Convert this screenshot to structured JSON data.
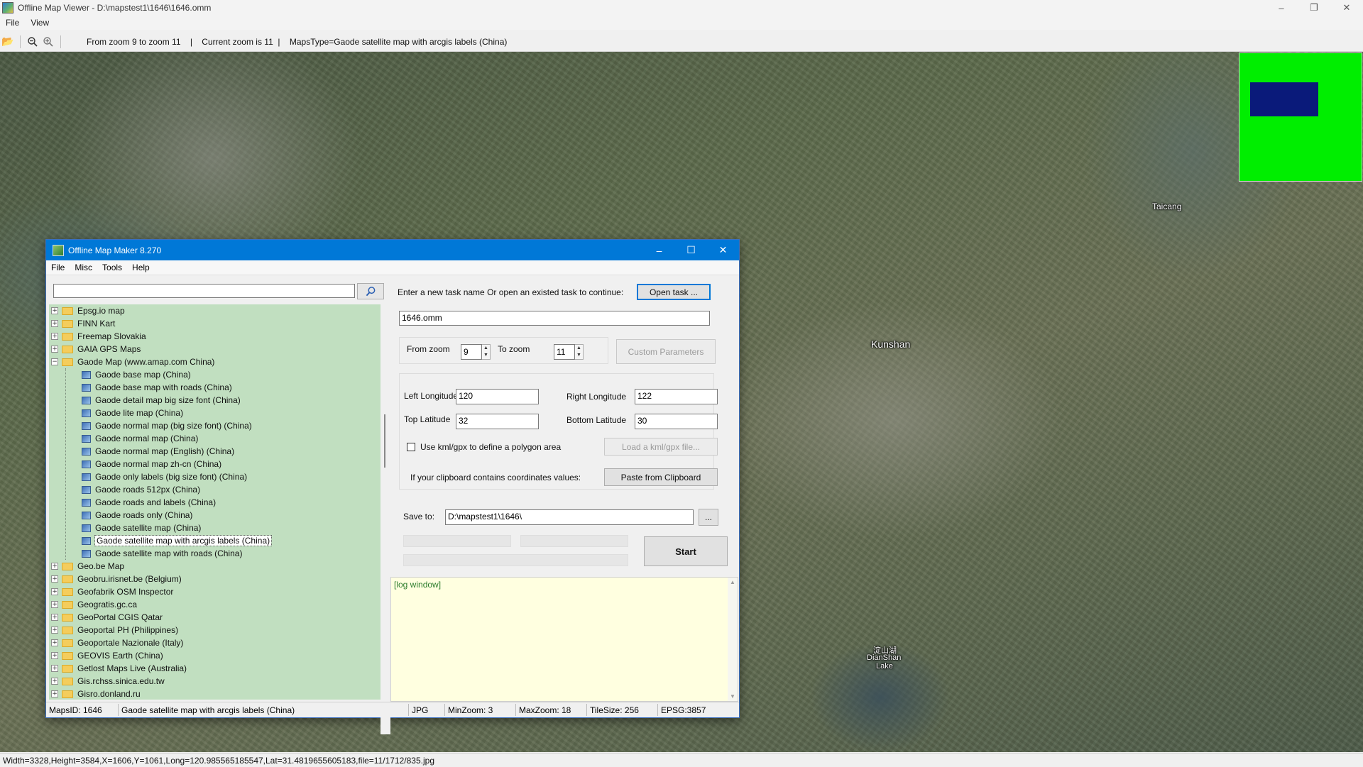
{
  "window": {
    "title": "Offline Map Viewer - D:\\mapstest1\\1646\\1646.omm",
    "controls": {
      "minimize": "–",
      "restore": "❐",
      "close": "✕"
    }
  },
  "menu": {
    "file": "File",
    "view": "View"
  },
  "toolbar": {
    "open_icon": "folder-open-icon",
    "zoom_out_icon": "zoom-out-icon",
    "zoom_in_icon": "zoom-in-icon",
    "status": "From zoom 9 to zoom 11    |    Current zoom is 11  |    MapsType=Gaode satellite map with arcgis labels (China)"
  },
  "map": {
    "labels": {
      "taicang": "Taicang",
      "kunshan": "Kunshan",
      "dianshan_cn": "淀山湖",
      "dianshan_en1": "DianShan",
      "dianshan_en2": "Lake"
    },
    "minimap_colors": {
      "background": "#00ee00",
      "viewport": "#0a1a7a"
    }
  },
  "statusbar": {
    "text": "Width=3328,Height=3584,X=1606,Y=1061,Long=120.985565185547,Lat=31.4819655605183,file=11/1712/835.jpg"
  },
  "dialog": {
    "title": "Offline Map Maker 8.270",
    "menu": {
      "file": "File",
      "misc": "Misc",
      "tools": "Tools",
      "help": "Help"
    },
    "search": {
      "value": "",
      "placeholder": ""
    },
    "tree": {
      "top_items_1": [
        "Epsg.io map",
        "FINN Kart",
        "Freemap Slovakia",
        "GAIA GPS Maps"
      ],
      "expanded": "Gaode Map (www.amap.com China)",
      "children": [
        "Gaode base map (China)",
        "Gaode base map with roads (China)",
        "Gaode detail map big size font (China)",
        "Gaode lite map (China)",
        "Gaode normal map (big size font) (China)",
        "Gaode normal map (China)",
        "Gaode normal map (English) (China)",
        "Gaode normal map zh-cn (China)",
        "Gaode only labels (big size font) (China)",
        "Gaode roads 512px (China)",
        "Gaode roads and labels (China)",
        "Gaode roads only (China)",
        "Gaode satellite map (China)",
        "Gaode satellite map with arcgis labels (China)",
        "Gaode satellite map with roads (China)"
      ],
      "selected_index": 13,
      "top_items_2": [
        "Geo.be Map",
        "Geobru.irisnet.be (Belgium)",
        "Geofabrik OSM Inspector",
        "Geogratis.gc.ca",
        "GeoPortal CGIS Qatar",
        "Geoportal PH (Philippines)",
        "Geoportale Nazionale (Italy)",
        "GEOVIS Earth (China)",
        "Getlost Maps Live (Australia)",
        "Gis.rchss.sinica.edu.tw",
        "Gisro.donland.ru"
      ]
    },
    "task": {
      "prompt": "Enter a new task name Or open an existed task to continue:",
      "open_button": "Open task ...",
      "name_value": "1646.omm"
    },
    "zoom": {
      "from_label": "From zoom",
      "from_value": "9",
      "to_label": "To zoom",
      "to_value": "11",
      "custom_button": "Custom Parameters"
    },
    "bounds": {
      "left_lon_label": "Left Longitude",
      "left_lon_value": "120",
      "right_lon_label": "Right Longitude",
      "right_lon_value": "122",
      "top_lat_label": "Top Latitude",
      "top_lat_value": "32",
      "bottom_lat_label": "Bottom Latitude",
      "bottom_lat_value": "30",
      "kml_checkbox_label": "Use kml/gpx to define a polygon area",
      "kml_checked": false,
      "load_kml_button": "Load a kml/gpx file...",
      "clipboard_label": "If your clipboard contains coordinates values:",
      "paste_button": "Paste from Clipboard"
    },
    "save": {
      "label": "Save to:",
      "value": "D:\\mapstest1\\1646\\",
      "browse_button": "..."
    },
    "start_button": "Start",
    "log": {
      "text": "[log window]"
    },
    "status": {
      "maps_id": "MapsID: 1646",
      "map_name": "Gaode satellite map with arcgis labels (China)",
      "format": "JPG",
      "min_zoom": "MinZoom: 3",
      "max_zoom": "MaxZoom: 18",
      "tile_size": "TileSize: 256",
      "epsg": "EPSG:3857"
    }
  }
}
